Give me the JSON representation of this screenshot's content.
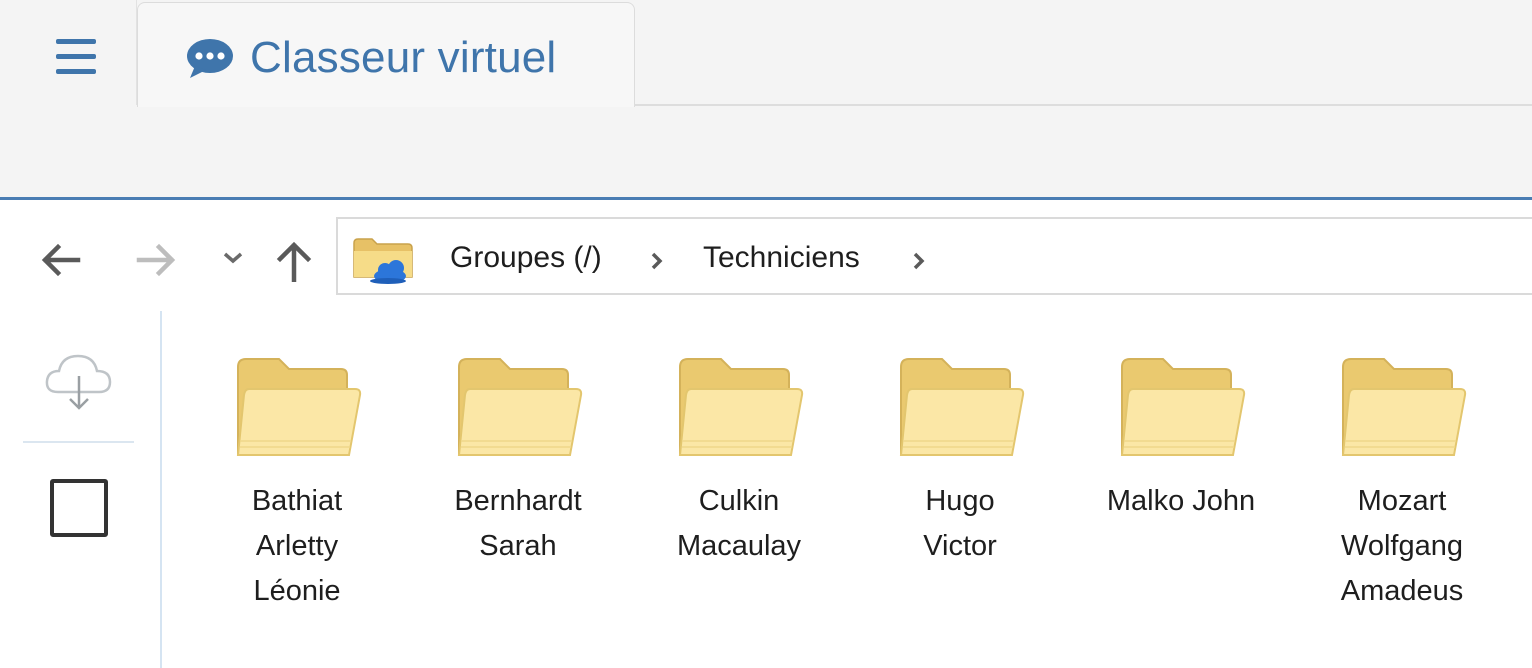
{
  "header": {
    "menu_icon": "hamburger-menu-icon",
    "tab": {
      "icon": "speech-bubble-icon",
      "title": "Classeur virtuel"
    },
    "accent_color": "#3f75ab"
  },
  "toolbar": {
    "back_icon": "arrow-left-icon",
    "forward_icon": "arrow-right-icon",
    "history_icon": "chevron-down-icon",
    "up_icon": "arrow-up-icon",
    "address": {
      "root_icon": "cloud-folder-icon",
      "crumbs": [
        "Groupes (/)",
        "Techniciens"
      ]
    }
  },
  "rail": {
    "download_icon": "cloud-download-icon",
    "select_all_icon": "checkbox-icon"
  },
  "folders": [
    {
      "lines": [
        "Bathiat",
        "Arletty",
        "Léonie"
      ]
    },
    {
      "lines": [
        "Bernhardt",
        "Sarah"
      ]
    },
    {
      "lines": [
        "Culkin",
        "Macaulay"
      ]
    },
    {
      "lines": [
        "Hugo",
        "Victor"
      ]
    },
    {
      "lines": [
        "Malko John"
      ]
    },
    {
      "lines": [
        "Mozart",
        "Wolfgang",
        "Amadeus"
      ]
    }
  ]
}
